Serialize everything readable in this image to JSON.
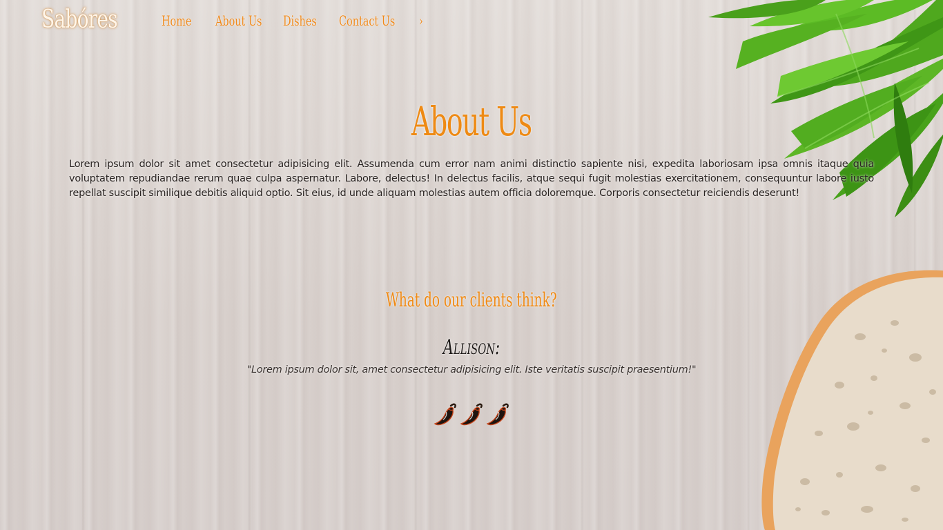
{
  "brand": {
    "name": "Sabóres"
  },
  "nav": {
    "items": [
      {
        "label": "Home"
      },
      {
        "label": "About Us"
      },
      {
        "label": "Dishes"
      },
      {
        "label": "Contact Us"
      },
      {
        "label": "›"
      }
    ]
  },
  "about": {
    "title": "About Us",
    "text": "Lorem ipsum dolor sit amet consectetur adipisicing elit. Assumenda cum error nam animi distinctio sapiente nisi, expedita laboriosam ipsa omnis itaque quia voluptatem repudiandae rerum quae culpa aspernatur. Labore, delectus! In delectus facilis, atque sequi fugit molestias exercitationem, consequuntur labore iusto repellat suscipit similique debitis aliquid optio. Sit eius, id unde aliquam molestias autem officia doloremque. Corporis consectetur reiciendis deserunt!"
  },
  "testimonials": {
    "title": "What do our clients think?",
    "reviews": [
      {
        "name": "Allison:",
        "quote": "\"Lorem ipsum dolor sit, amet consectetur adipisicing elit. Iste veritatis suscipit praesentium!\"",
        "rating": 3,
        "rating_icon": "chili-pepper-icon"
      }
    ]
  },
  "colors": {
    "accent": "#f08a1c",
    "text": "#2a2422",
    "pepper": "#c8451a"
  }
}
